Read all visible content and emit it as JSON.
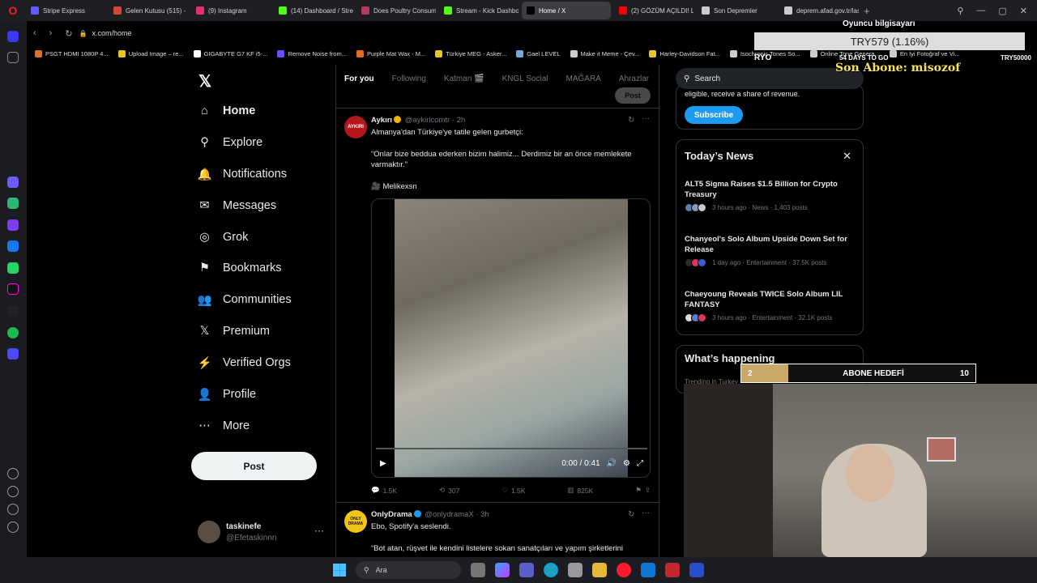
{
  "browser": {
    "tabs": [
      {
        "label": "Stripe Express",
        "color": "#635bff"
      },
      {
        "label": "Gelen Kutusu (515) - non",
        "color": "#d44638"
      },
      {
        "label": "(9) Instagram",
        "color": "#e1306c"
      },
      {
        "label": "(14) Dashboard / Stream",
        "color": "#53fc18"
      },
      {
        "label": "Does Poultry Consumpti",
        "color": "#b23b5b"
      },
      {
        "label": "Stream - Kick Dashboard",
        "color": "#53fc18"
      },
      {
        "label": "Home / X",
        "color": "#000000"
      },
      {
        "label": "(2) GÖZÜM AÇILDI! LON",
        "color": "#ff0000"
      },
      {
        "label": "Son Depremler",
        "color": "#cccccc"
      },
      {
        "label": "deprem.afad.gov.tr/last-",
        "color": "#cccccc"
      }
    ],
    "active_tab": 6,
    "url": "x.com/home",
    "bookmarks": [
      {
        "label": "PSGT HDMI 1080P 4...",
        "color": "#e46c1e"
      },
      {
        "label": "Upload Image – re...",
        "color": "#e8c520"
      },
      {
        "label": "GIGABYTE G7 KF i5-...",
        "color": "#ffffff"
      },
      {
        "label": "Remove Noise from...",
        "color": "#6b4dff"
      },
      {
        "label": "Purple Mat Wax - M...",
        "color": "#e46c1e"
      },
      {
        "label": "Türkiye MEG - Asker...",
        "color": "#e8c520"
      },
      {
        "label": "Gael LEVEL",
        "color": "#6fa8dc"
      },
      {
        "label": "Make it Meme - Çev...",
        "color": "#cccccc"
      },
      {
        "label": "Harley-Davidson Fat...",
        "color": "#e8c520"
      },
      {
        "label": "Isochronic Tones So...",
        "color": "#cccccc"
      },
      {
        "label": "Online Tone Genera...",
        "color": "#cccccc"
      },
      {
        "label": "En İyi Fotoğraf ve Vi...",
        "color": "#cccccc"
      }
    ]
  },
  "x": {
    "logo": "𝕏",
    "nav": [
      {
        "label": "Home",
        "icon": "home-icon",
        "glyph": "⌂"
      },
      {
        "label": "Explore",
        "icon": "search-icon",
        "glyph": "⚲"
      },
      {
        "label": "Notifications",
        "icon": "bell-icon",
        "glyph": "🔔"
      },
      {
        "label": "Messages",
        "icon": "mail-icon",
        "glyph": "✉"
      },
      {
        "label": "Grok",
        "icon": "grok-icon",
        "glyph": "◎"
      },
      {
        "label": "Bookmarks",
        "icon": "bookmark-icon",
        "glyph": "⚑"
      },
      {
        "label": "Communities",
        "icon": "communities-icon",
        "glyph": "👥"
      },
      {
        "label": "Premium",
        "icon": "x-icon",
        "glyph": "𝕏"
      },
      {
        "label": "Verified Orgs",
        "icon": "lightning-icon",
        "glyph": "⚡"
      },
      {
        "label": "Profile",
        "icon": "person-icon",
        "glyph": "👤"
      },
      {
        "label": "More",
        "icon": "more-icon",
        "glyph": "⋯"
      }
    ],
    "post_button": "Post",
    "user": {
      "name": "taskinefe",
      "handle": "@Efetaskinnn"
    },
    "timeline_tabs": [
      "For you",
      "Following",
      "Katman 🎬",
      "KNGL Social",
      "MAĞARA",
      "Ahrazlar"
    ],
    "compose_post": "Post",
    "tweets": [
      {
        "name": "Aykırı",
        "handle": "@aykiricomtr · 2h",
        "avatar_text": "AYKIRI",
        "lines": [
          "Almanya'dan Türkiye'ye tatile gelen gurbetçi:",
          "",
          "“Onlar bize beddua ederken bizim halimiz... Derdimiz bir an önce memlekete varmaktır.”",
          "",
          "🎥 Melikexsn"
        ],
        "video_time": "0:00 / 0:41",
        "replies": "1.5K",
        "reposts": "307",
        "likes": "1.5K",
        "views": "825K"
      },
      {
        "name": "OnlyDrama",
        "handle": "@onlydramaX · 3h",
        "avatar_text": "ONLY DRAMA",
        "lines": [
          "Ebo, Spotify'a seslendi.",
          "",
          "“Bot atan, rüşvet ile kendini listelere sokan sanatçıları ve yapım şirketlerini"
        ]
      }
    ],
    "search_placeholder": "Search",
    "premium_text": "eligible, receive a share of revenue.",
    "subscribe": "Subscribe",
    "news_title": "Today’s News",
    "news": [
      {
        "title": "ALT5 Sigma Raises $1.5 Billion for Crypto Treasury",
        "meta": "3 hours ago · News · 1,403 posts"
      },
      {
        "title": "Chanyeol's Solo Album Upside Down Set for Release",
        "meta": "1 day ago · Entertainment · 37.5K posts"
      },
      {
        "title": "Chaeyoung Reveals TWICE Solo Album LIL FANTASY",
        "meta": "3 hours ago · Entertainment · 32.1K posts"
      }
    ],
    "happening_title": "What’s happening",
    "happening_sub": "Trending in Turkey"
  },
  "overlay": {
    "top": "Oyuncu bilgisayarı",
    "try": "TRY579 (1.16%)",
    "left_code": "RYO",
    "days": "54 DAYS TO GO",
    "right_code": "TRY50000",
    "sub": "Son Abone: misozof",
    "goal_label": "ABONE HEDEFİ",
    "goal_current": "2",
    "goal_total": "10",
    "goal_fraction": 0.2
  },
  "taskbar": {
    "search": "Ara"
  }
}
